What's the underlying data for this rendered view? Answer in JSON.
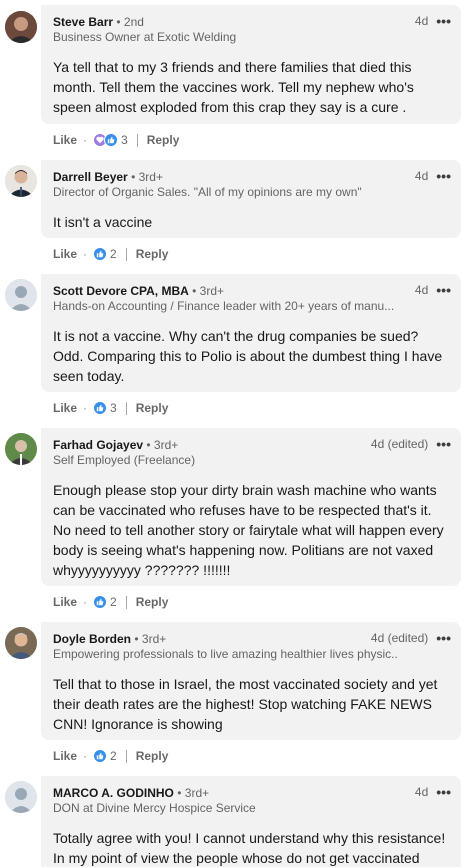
{
  "comments": [
    {
      "name": "Steve Barr",
      "degree": "• 2nd",
      "headline": "Business Owner at Exotic Welding",
      "time": "4d",
      "text": "Ya tell that to my 3 friends and there families that died this month. Tell them the vaccines work. Tell my nephew who's speen almost exploded from this crap they say is a cure .",
      "actions": {
        "like": "Like",
        "reply": "Reply",
        "reaction_count": "3"
      },
      "reactions": [
        "love",
        "like"
      ]
    },
    {
      "name": "Darrell Beyer",
      "degree": "• 3rd+",
      "headline": "Director of Organic Sales. \"All of my opinions are my own\"",
      "time": "4d",
      "text": "It isn't a vaccine",
      "actions": {
        "like": "Like",
        "reply": "Reply",
        "reaction_count": "2"
      },
      "reactions": [
        "like"
      ]
    },
    {
      "name": "Scott Devore CPA, MBA",
      "degree": "• 3rd+",
      "headline": "Hands-on Accounting / Finance leader with 20+ years of manu...",
      "time": "4d",
      "text": "It is not a vaccine. Why can't the drug companies be sued? Odd. Comparing this to Polio is about the dumbest thing I have seen today.",
      "actions": {
        "like": "Like",
        "reply": "Reply",
        "reaction_count": "3"
      },
      "reactions": [
        "like"
      ]
    },
    {
      "name": "Farhad Gojayev",
      "degree": "• 3rd+",
      "headline": "Self Employed (Freelance)",
      "time": "4d (edited)",
      "text": "Enough please stop your dirty brain wash machine who wants can be vaccinated who refuses have to be respected that's it. No need to tell another story or fairytale what will happen every body is seeing what's happening now. Politians are not vaxed whyyyyyyyyyy ??????? !!!!!!!",
      "actions": {
        "like": "Like",
        "reply": "Reply",
        "reaction_count": "2"
      },
      "reactions": [
        "like"
      ]
    },
    {
      "name": "Doyle Borden",
      "degree": "• 3rd+",
      "headline": "Empowering professionals to live amazing healthier lives physic...",
      "time": "4d (edited)",
      "text": "Tell that to those in Israel, the most vaccinated society and yet their death rates are the highest! Stop watching FAKE NEWS CNN! Ignorance is showing",
      "actions": {
        "like": "Like",
        "reply": "Reply",
        "reaction_count": "2"
      },
      "reactions": [
        "like"
      ]
    },
    {
      "name": "MARCO A. GODINHO",
      "degree": "• 3rd+",
      "headline": "DON at Divine Mercy Hospice Service",
      "time": "4d",
      "text": "Totally agree with you! I cannot understand why this resistance! In my point of view the people whose do not get vaccinated"
    }
  ],
  "icons": {
    "more": "more-dots-icon",
    "like": "thumbs-up-icon",
    "love": "heart-icon"
  },
  "colors": {
    "like_blue": "#378fe9",
    "bubble": "#f2f2f2"
  }
}
